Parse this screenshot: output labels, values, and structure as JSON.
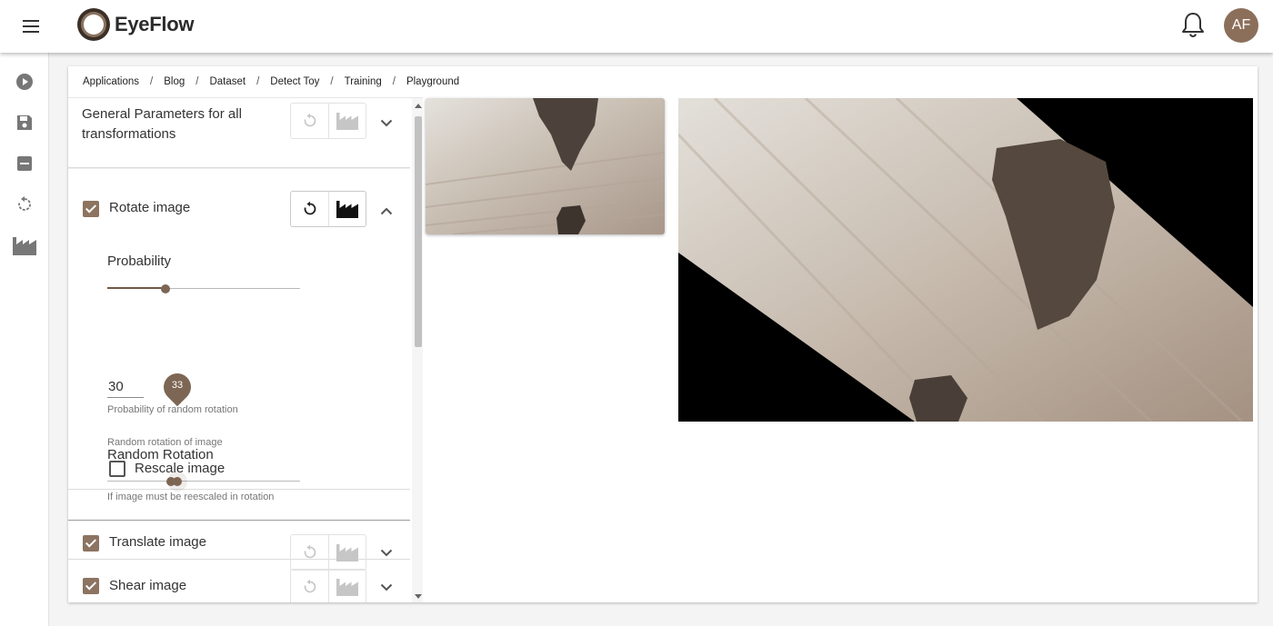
{
  "app": {
    "name": "EyeFlow",
    "user_initials": "AF"
  },
  "icons": {
    "menu": "menu-icon",
    "notifications": "bell-icon",
    "rail": [
      "play-circle-icon",
      "save-icon",
      "minus-box-icon",
      "reset-icon",
      "factory-icon"
    ],
    "reset": "reset-icon",
    "factory": "factory-icon",
    "expand": "chevron-down-icon",
    "collapse": "chevron-up-icon"
  },
  "breadcrumb": [
    "Applications",
    "Blog",
    "Dataset",
    "Detect Toy",
    "Training",
    "Playground"
  ],
  "breadcrumb_separator": "/",
  "sections": {
    "general": {
      "title_line1": "General Parameters for all",
      "title_line2": "transformations"
    },
    "rotate": {
      "label": "Rotate image",
      "checked": true,
      "expanded": true,
      "probability_label": "Probability",
      "probability_value": "30",
      "probability_hint": "Probability of random rotation",
      "probability_fraction": 0.3,
      "random_rotation_label": "Random Rotation",
      "random_rotation_hint": "Random rotation of image",
      "random_rotation_low": 27,
      "random_rotation_high": 33,
      "random_rotation_high_label": "33",
      "rescale_label": "Rescale image",
      "rescale_checked": false,
      "rescale_hint": "If image must be reescaled in rotation"
    },
    "translate": {
      "label": "Translate image",
      "checked": true
    },
    "shear": {
      "label": "Shear image",
      "checked": true
    }
  },
  "colors": {
    "accent": "#8c7461",
    "slider": "#7d6654",
    "avatar": "#8c6f5a"
  }
}
